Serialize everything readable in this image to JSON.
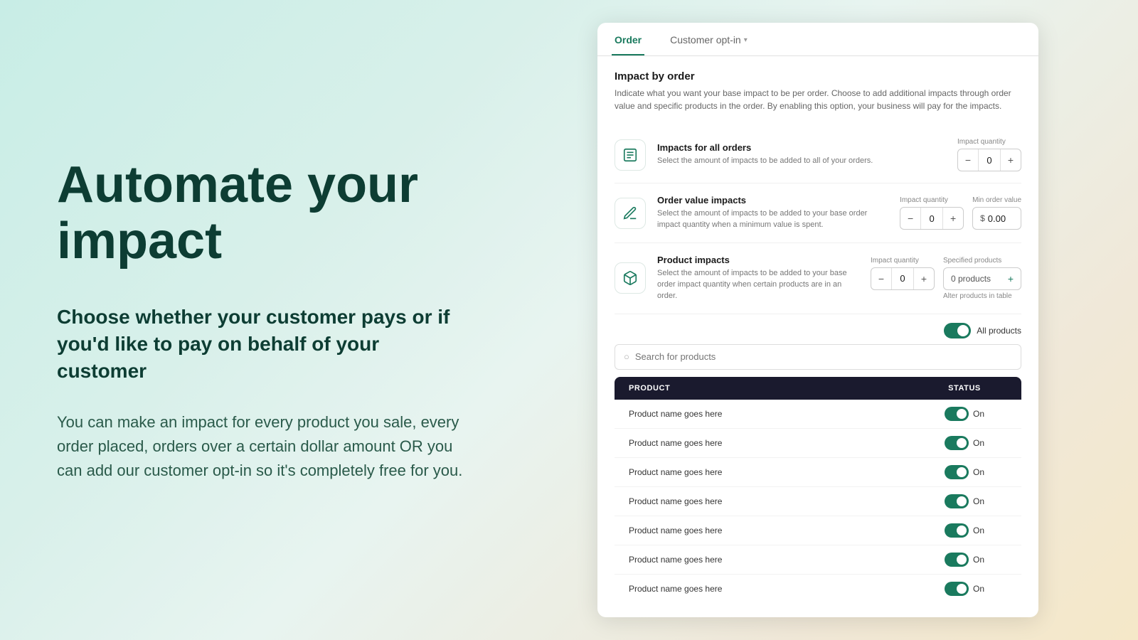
{
  "left": {
    "headline_line1": "Automate your",
    "headline_line2": "impact",
    "subheadline": "Choose whether your customer pays or if you'd like to pay on behalf of your customer",
    "body_text": "You can make an impact for every product you sale, every order placed, orders over a certain dollar amount OR you can add our customer opt-in so it's completely free for you."
  },
  "card": {
    "tabs": [
      {
        "label": "Order",
        "active": true
      },
      {
        "label": "Customer opt-in",
        "active": false,
        "has_chevron": true
      }
    ],
    "section_title": "Impact by order",
    "section_desc": "Indicate what you want your base impact to be per order. Choose to add additional impacts through order value and specific products in the order. By enabling this option, your business will pay for the impacts.",
    "impact_rows": [
      {
        "id": "all-orders",
        "icon": "📋",
        "name": "Impacts for all orders",
        "desc": "Select the amount of impacts to be added to all of your orders.",
        "qty_label": "Impact quantity",
        "qty_value": "0",
        "has_min_order": false,
        "has_specified": false
      },
      {
        "id": "order-value",
        "icon": "✏️",
        "name": "Order value impacts",
        "desc": "Select the amount of impacts to be added to your base order impact quantity when a minimum value is spent.",
        "qty_label": "Impact quantity",
        "qty_value": "0",
        "has_min_order": true,
        "min_order_label": "Min order value",
        "min_order_symbol": "$",
        "min_order_value": "0.00",
        "has_specified": false
      },
      {
        "id": "product-impacts",
        "icon": "📦",
        "name": "Product impacts",
        "desc": "Select the amount of impacts to be added to your base order impact quantity when certain products are in an order.",
        "qty_label": "Impact quantity",
        "qty_value": "0",
        "has_min_order": false,
        "has_specified": true,
        "specified_label": "Specified products",
        "specified_value": "0 products",
        "alter_text": "Alter products in table"
      }
    ],
    "toggle_label": "All products",
    "search_placeholder": "Search for products",
    "table": {
      "columns": [
        "PRODUCT",
        "STATUS"
      ],
      "rows": [
        {
          "product": "Product name goes here",
          "status": "On"
        },
        {
          "product": "Product name goes here",
          "status": "On"
        },
        {
          "product": "Product name goes here",
          "status": "On"
        },
        {
          "product": "Product name goes here",
          "status": "On"
        },
        {
          "product": "Product name goes here",
          "status": "On"
        },
        {
          "product": "Product name goes here",
          "status": "On"
        },
        {
          "product": "Product name goes here",
          "status": "On"
        }
      ]
    }
  }
}
